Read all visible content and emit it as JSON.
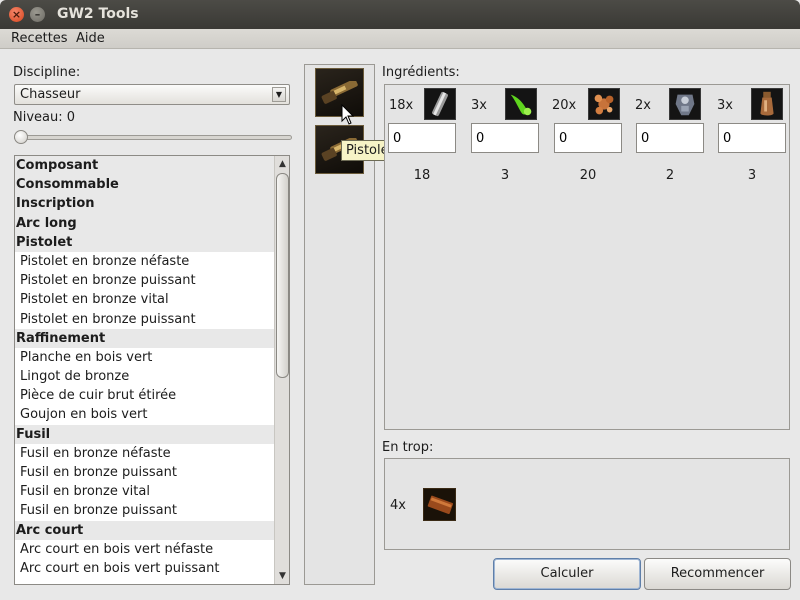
{
  "window": {
    "title": "GW2 Tools"
  },
  "menu": {
    "items": [
      "Recettes",
      "Aide"
    ]
  },
  "left": {
    "discipline_label": "Discipline:",
    "discipline_value": "Chasseur",
    "level_label": "Niveau: 0",
    "level_fraction": 0,
    "recipes": [
      {
        "type": "cat",
        "label": "Composant"
      },
      {
        "type": "cat",
        "label": "Consommable"
      },
      {
        "type": "cat",
        "label": "Inscription"
      },
      {
        "type": "cat",
        "label": "Arc long"
      },
      {
        "type": "cat",
        "label": "Pistolet"
      },
      {
        "type": "item",
        "label": "Pistolet en bronze néfaste"
      },
      {
        "type": "item",
        "label": "Pistolet en bronze puissant"
      },
      {
        "type": "item",
        "label": "Pistolet en bronze vital"
      },
      {
        "type": "item",
        "label": "Pistolet en bronze puissant"
      },
      {
        "type": "cat",
        "label": "Raffinement"
      },
      {
        "type": "item",
        "label": "Planche en bois vert"
      },
      {
        "type": "item",
        "label": "Lingot de bronze"
      },
      {
        "type": "item",
        "label": "Pièce de cuir brut étirée"
      },
      {
        "type": "item",
        "label": "Goujon en bois vert"
      },
      {
        "type": "cat",
        "label": "Fusil"
      },
      {
        "type": "item",
        "label": "Fusil en bronze néfaste"
      },
      {
        "type": "item",
        "label": "Fusil en bronze puissant"
      },
      {
        "type": "item",
        "label": "Fusil en bronze vital"
      },
      {
        "type": "item",
        "label": "Fusil en bronze puissant"
      },
      {
        "type": "cat",
        "label": "Arc court"
      },
      {
        "type": "item",
        "label": "Arc court en bois vert néfaste"
      },
      {
        "type": "item",
        "label": "Arc court en bois vert puissant"
      }
    ]
  },
  "selected_recipes": {
    "icons": [
      "pistol-icon",
      "pistol-icon"
    ],
    "tooltip": "Pistolet en bronze néfaste"
  },
  "ingredients": {
    "label": "Ingrédients:",
    "items": [
      {
        "qty": "18x",
        "icon": "bronze-ingot-icon",
        "input": "0",
        "total": "18",
        "color": "#8e8e8e"
      },
      {
        "qty": "3x",
        "icon": "green-sap-icon",
        "input": "0",
        "total": "3",
        "color": "#5fd51e"
      },
      {
        "qty": "20x",
        "icon": "copper-ore-icon",
        "input": "0",
        "total": "20",
        "color": "#c7733a"
      },
      {
        "qty": "2x",
        "icon": "armor-icon",
        "input": "0",
        "total": "2",
        "color": "#8b94a6"
      },
      {
        "qty": "3x",
        "icon": "vial-icon",
        "input": "0",
        "total": "3",
        "color": "#a86a3b"
      }
    ]
  },
  "surplus": {
    "label": "En trop:",
    "qty": "4x",
    "icon": "wood-plank-icon"
  },
  "buttons": {
    "calculate": "Calculer",
    "reset": "Recommencer"
  }
}
